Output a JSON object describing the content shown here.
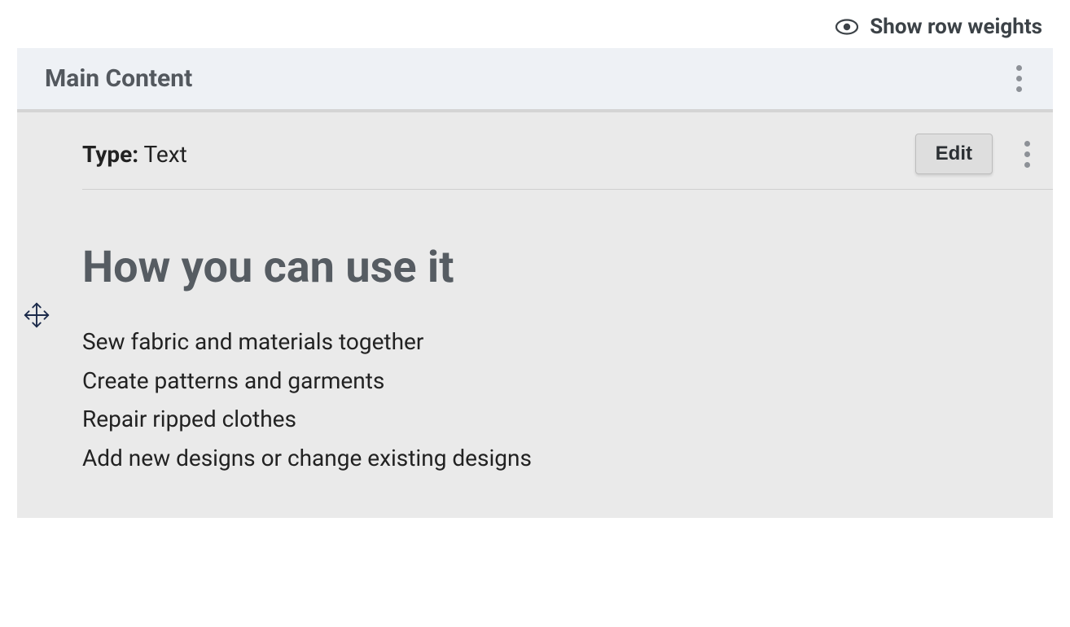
{
  "toolbar": {
    "show_weights_label": "Show row weights"
  },
  "panel": {
    "title": "Main Content"
  },
  "item": {
    "type_key": "Type:",
    "type_value": "Text",
    "edit_label": "Edit",
    "content": {
      "heading": "How you can use it",
      "lines": [
        "Sew fabric and materials together",
        "Create patterns and garments",
        "Repair ripped clothes",
        "Add new designs or change existing designs"
      ]
    }
  }
}
